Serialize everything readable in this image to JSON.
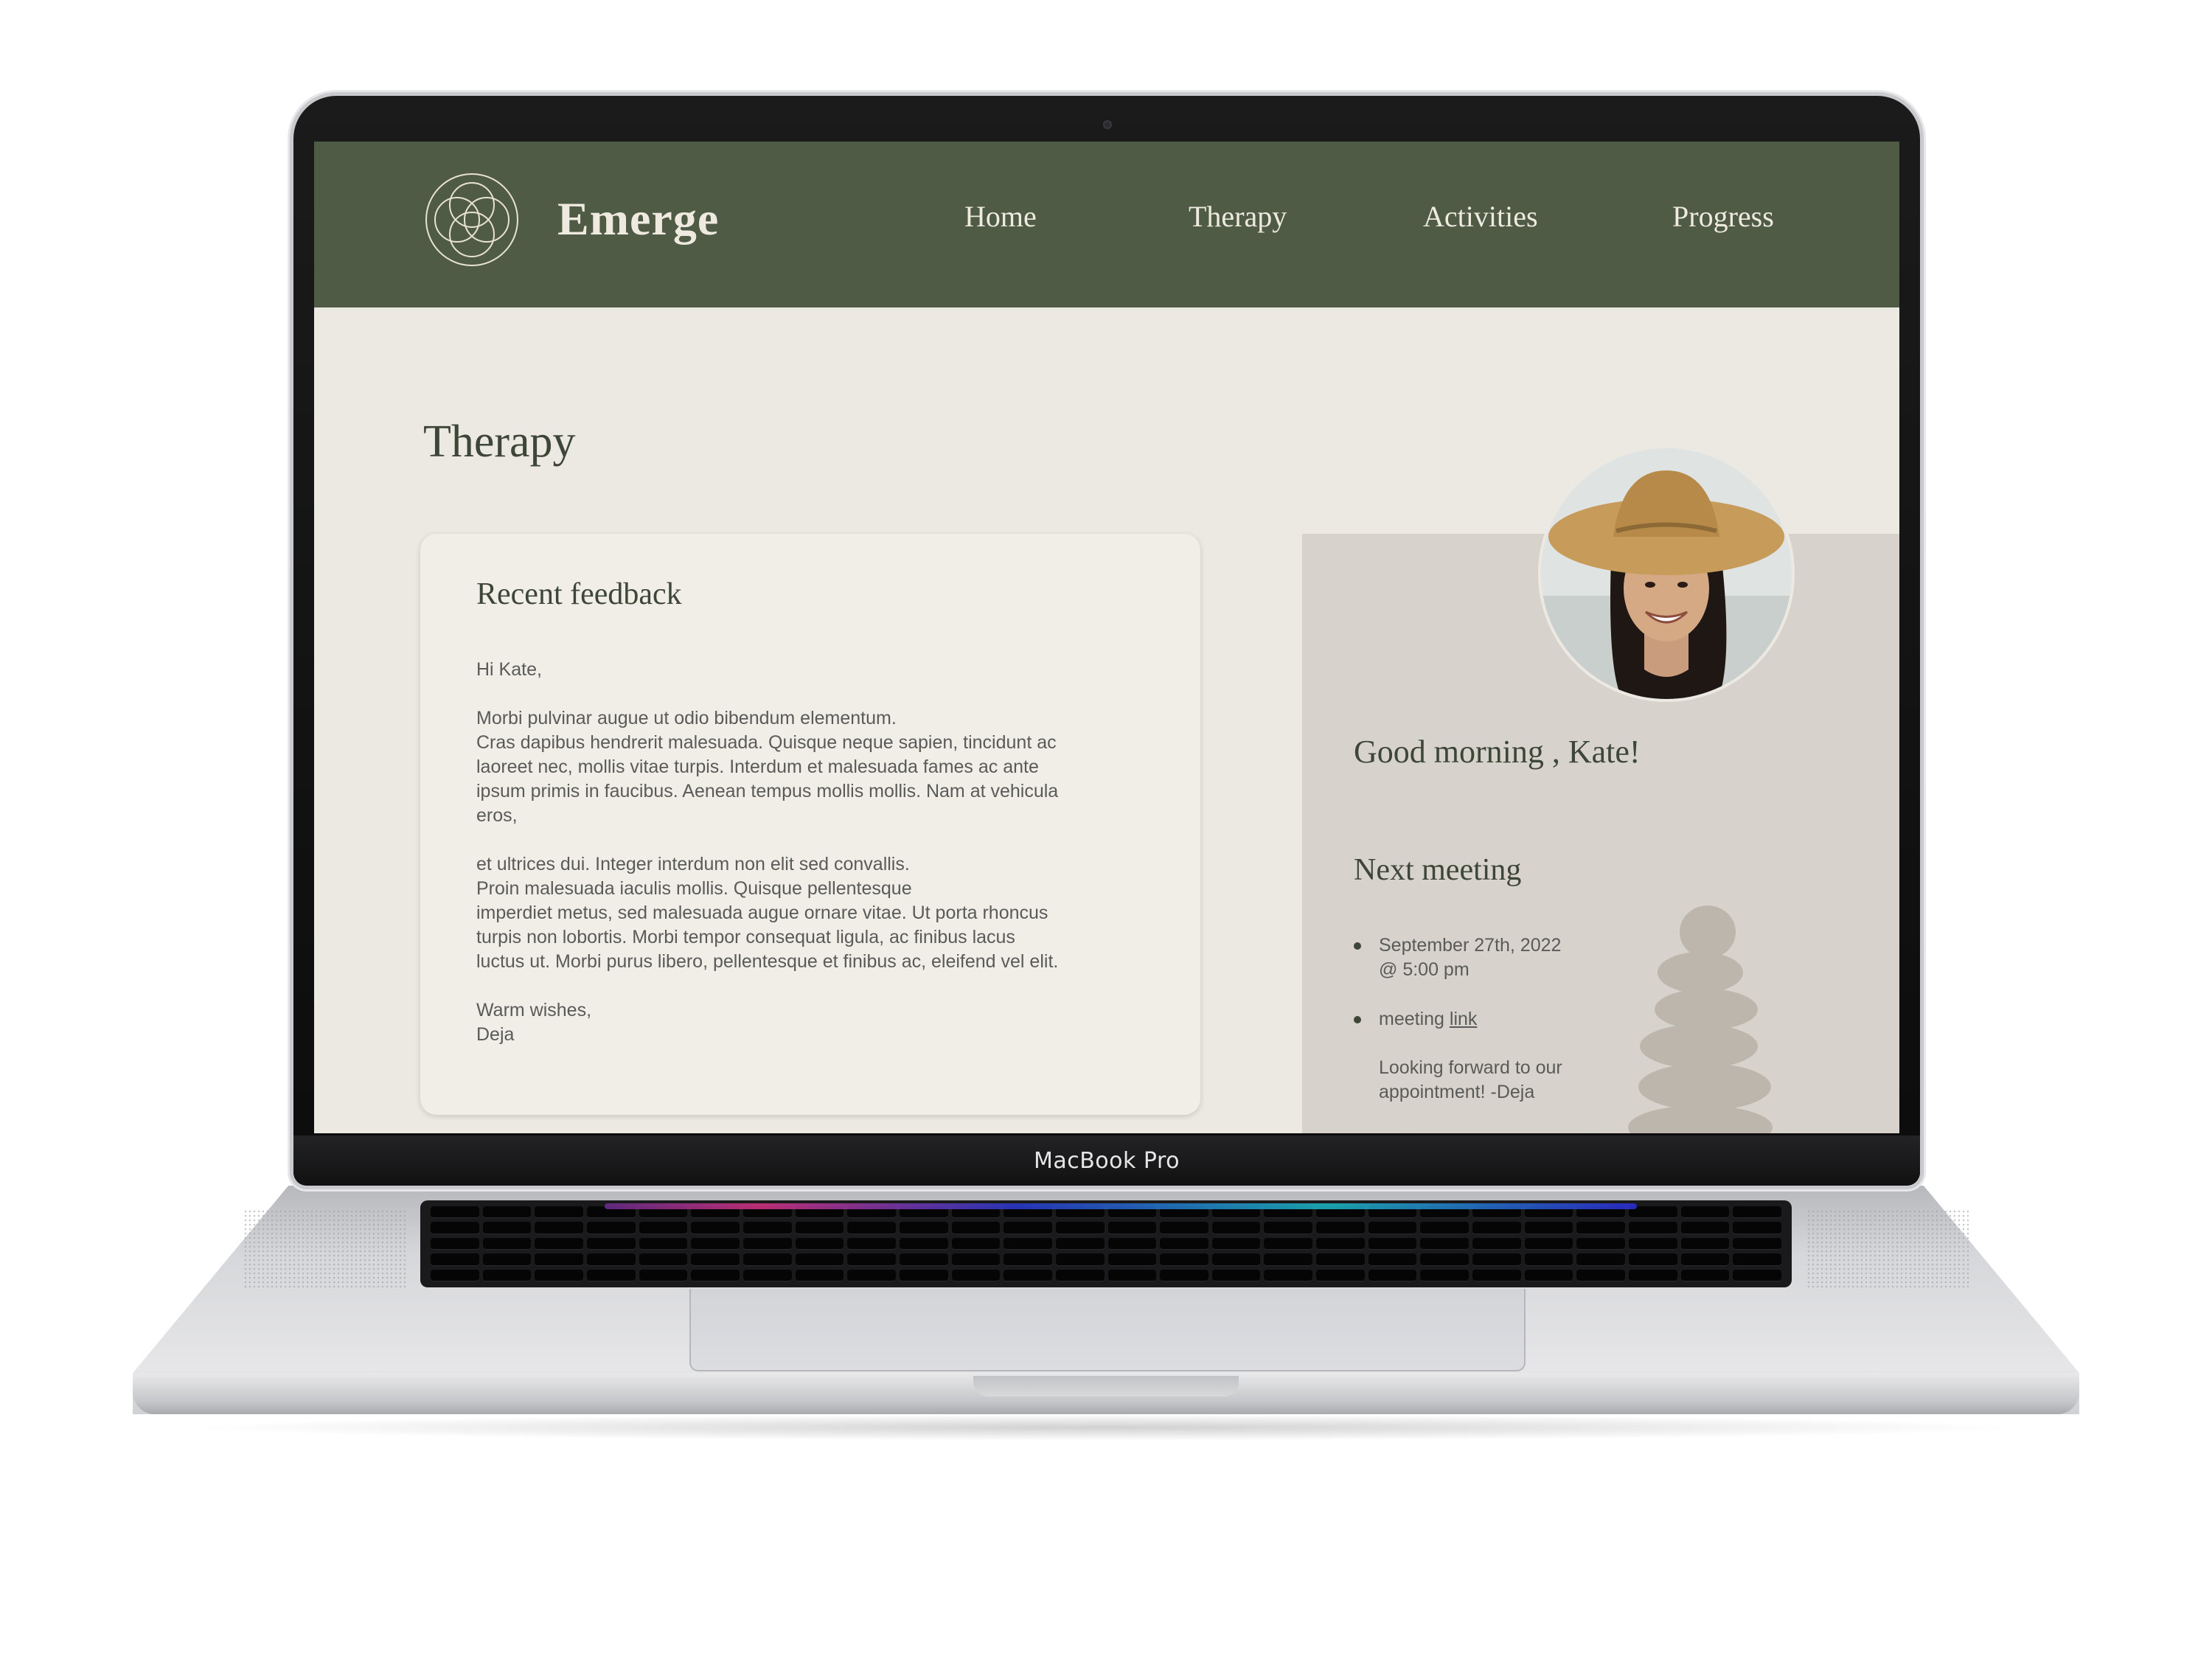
{
  "device": {
    "label": "MacBook Pro"
  },
  "site": {
    "brand": "Emerge",
    "logo_icon": "interlocking-circles-icon"
  },
  "nav": {
    "items": [
      {
        "label": "Home"
      },
      {
        "label": "Therapy"
      },
      {
        "label": "Activities"
      },
      {
        "label": "Progress"
      }
    ]
  },
  "page": {
    "title": "Therapy"
  },
  "feedback": {
    "title": "Recent feedback",
    "greeting": "Hi Kate,",
    "paragraph1": [
      "Morbi pulvinar augue ut odio bibendum elementum.",
      "Cras dapibus hendrerit malesuada. Quisque neque sapien, tincidunt ac",
      "laoreet nec, mollis vitae turpis. Interdum et malesuada fames ac ante",
      "ipsum primis in faucibus. Aenean tempus mollis mollis. Nam at vehicula",
      "eros,"
    ],
    "paragraph2": [
      "et ultrices dui. Integer interdum non elit sed convallis.",
      "Proin malesuada iaculis mollis. Quisque pellentesque",
      "imperdiet metus, sed malesuada augue ornare vitae. Ut porta rhoncus",
      "turpis non lobortis. Morbi tempor consequat ligula, ac finibus lacus",
      "luctus ut. Morbi purus libero, pellentesque et finibus ac, eleifend vel elit."
    ],
    "signoff": "Warm wishes,",
    "signature": "Deja"
  },
  "profile": {
    "avatar": "user-avatar-photo",
    "greeting": "Good morning , Kate!"
  },
  "meeting": {
    "title": "Next meeting",
    "date_line1": "September 27th, 2022",
    "date_line2": "@ 5:00 pm",
    "link_prefix": "meeting ",
    "link_text": "link",
    "closing_line1": "Looking forward to our",
    "closing_line2": "appointment!   -Deja"
  },
  "colors": {
    "nav_bg": "#4f5b45",
    "page_bg": "#ece8e2",
    "card_bg": "#f1eee8",
    "panel_bg": "#d7d3cc",
    "heading": "#3d4637"
  }
}
